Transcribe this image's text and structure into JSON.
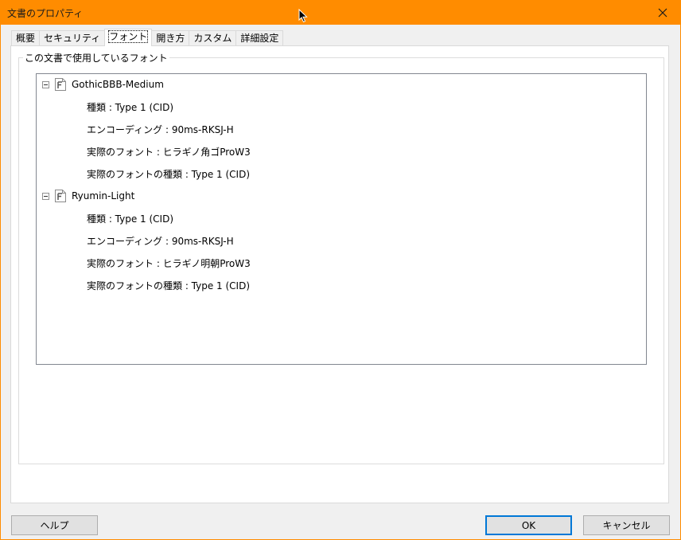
{
  "window": {
    "title": "文書のプロパティ",
    "close_glyph": "✕",
    "accent": "#ff8c00"
  },
  "tabs": [
    {
      "label": "概要"
    },
    {
      "label": "セキュリティ"
    },
    {
      "label": "フォント",
      "active": true
    },
    {
      "label": "開き方"
    },
    {
      "label": "カスタム"
    },
    {
      "label": "詳細設定"
    }
  ],
  "fonts_group": {
    "legend": "この文書で使用しているフォント",
    "fonts": [
      {
        "icon": "font-file-icon",
        "name": "GothicBBB-Medium",
        "details": [
          "種類 : Type 1 (CID)",
          "エンコーディング : 90ms-RKSJ-H",
          "実際のフォント : ヒラギノ角ゴProW3",
          "実際のフォントの種類 : Type 1 (CID)"
        ]
      },
      {
        "icon": "font-file-icon",
        "name": "Ryumin-Light",
        "details": [
          "種類 : Type 1 (CID)",
          "エンコーディング : 90ms-RKSJ-H",
          "実際のフォント : ヒラギノ明朝ProW3",
          "実際のフォントの種類 : Type 1 (CID)"
        ]
      }
    ]
  },
  "buttons": {
    "help": "ヘルプ",
    "ok": "OK",
    "cancel": "キャンセル"
  }
}
